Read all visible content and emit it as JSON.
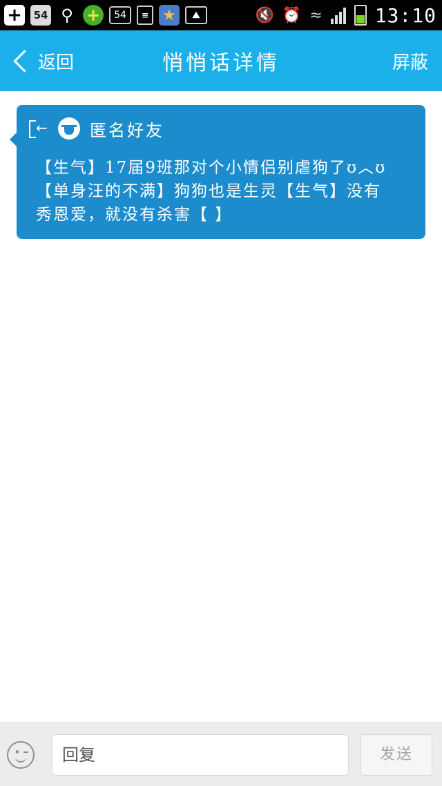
{
  "status_bar": {
    "left_icons": [
      "plus-icon",
      "54-app-icon",
      "search-icon",
      "green-plus-icon",
      "54-badge-icon",
      "document-icon",
      "star-app-icon",
      "image-icon"
    ],
    "badge_text_1": "54",
    "badge_text_2": "54",
    "right_icons": [
      "mute-icon",
      "alarm-icon",
      "wifi-icon",
      "signal-icon",
      "battery-icon"
    ],
    "time": "13:10"
  },
  "header": {
    "back_label": "返回",
    "title": "悄悄话详情",
    "block_label": "屏蔽"
  },
  "message": {
    "sender": "匿名好友",
    "text": "【生气】17届9班那对个小情侣别虐狗了ʊ︿ʊ【单身汪的不满】狗狗也是生灵【生气】没有秀恩爱，就没有杀害【 】"
  },
  "reply_bar": {
    "placeholder": "回复",
    "send_label": "发送"
  },
  "colors": {
    "header_bg": "#1cb0ea",
    "card_bg": "#1d8ccd",
    "status_bg": "#000000"
  }
}
